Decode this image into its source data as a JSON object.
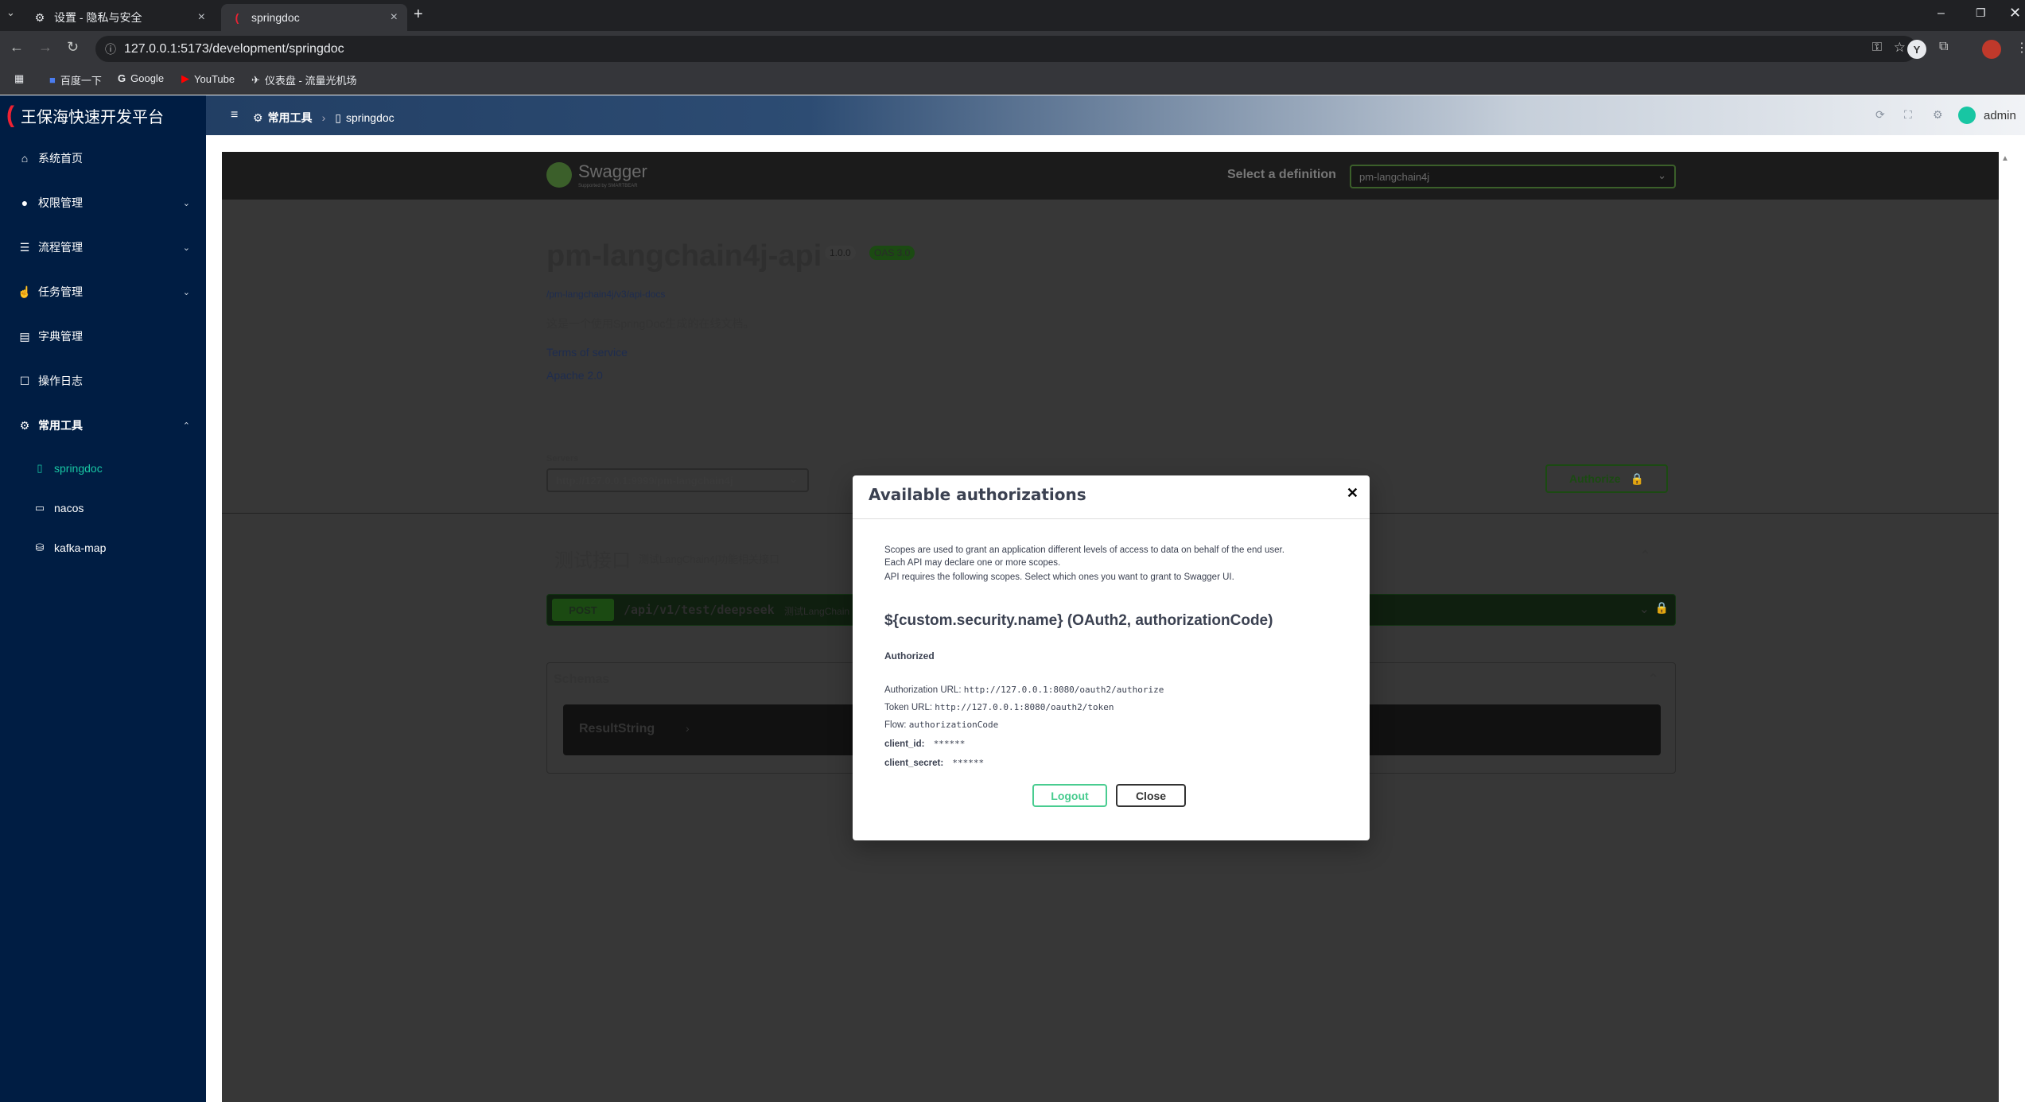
{
  "browser": {
    "tabs": [
      {
        "title": "设置 - 隐私与安全",
        "icon": "gear-icon"
      },
      {
        "title": "springdoc",
        "icon": "app-logo-icon"
      }
    ],
    "url": "127.0.0.1:5173/development/springdoc",
    "bookmarks": [
      "百度一下",
      "Google",
      "YouTube",
      "仪表盘 - 流量光机场"
    ]
  },
  "app": {
    "brand": "王保海快速开发平台",
    "breadcrumb": [
      "常用工具",
      "springdoc"
    ],
    "user": "admin",
    "accent_color": "#18c6a3",
    "sidebar_color": "#001d43"
  },
  "sidebar": {
    "items": [
      {
        "label": "系统首页",
        "icon": "home-icon"
      },
      {
        "label": "权限管理",
        "icon": "user-icon"
      },
      {
        "label": "流程管理",
        "icon": "sliders-icon"
      },
      {
        "label": "任务管理",
        "icon": "hand-icon"
      },
      {
        "label": "字典管理",
        "icon": "book-icon"
      },
      {
        "label": "操作日志",
        "icon": "message-icon"
      },
      {
        "label": "常用工具",
        "icon": "gear-icon"
      }
    ],
    "sub_items": [
      {
        "label": "springdoc",
        "icon": "page-icon"
      },
      {
        "label": "nacos",
        "icon": "monitor-icon"
      },
      {
        "label": "kafka-map",
        "icon": "map-icon"
      }
    ]
  },
  "swagger": {
    "logo": "Swagger",
    "logo_sub": "Supported by SMARTBEAR",
    "select_definition_label": "Select a definition",
    "definition": "pm-langchain4j",
    "title": "pm-langchain4j-api",
    "version": "1.0.0",
    "oas": "OAS 3.0",
    "api_docs_link": "/pm-langchain4j/v3/api-docs",
    "description": "这是一个使用SpringDoc生成的在线文档。",
    "terms": "Terms of service",
    "license": "Apache 2.0",
    "servers_label": "Servers",
    "server": "http://127.0.0.1:9999/pm-langchain4j",
    "authorize_label": "Authorize",
    "tag_name": "测试接口",
    "tag_desc": "测试LangChain4j功能相关接口",
    "method": "POST",
    "path": "/api/v1/test/deepseek",
    "path_desc": "测试LangChain",
    "schemas_label": "Schemas",
    "schema_name": "ResultString"
  },
  "modal": {
    "title": "Available authorizations",
    "scopes_text_1": "Scopes are used to grant an application different levels of access to data on behalf of the end user.",
    "scopes_text_2": "Each API may declare one or more scopes.",
    "scopes_text_3": "API requires the following scopes. Select which ones you want to grant to Swagger UI.",
    "scheme": "${custom.security.name} (OAuth2, authorizationCode)",
    "authorized": "Authorized",
    "auth_url_label": "Authorization URL:",
    "auth_url": "http://127.0.0.1:8080/oauth2/authorize",
    "token_url_label": "Token URL:",
    "token_url": "http://127.0.0.1:8080/oauth2/token",
    "flow_label": "Flow:",
    "flow": "authorizationCode",
    "client_id_label": "client_id:",
    "client_id": "******",
    "client_secret_label": "client_secret:",
    "client_secret": "******",
    "logout_label": "Logout",
    "close_label": "Close"
  }
}
